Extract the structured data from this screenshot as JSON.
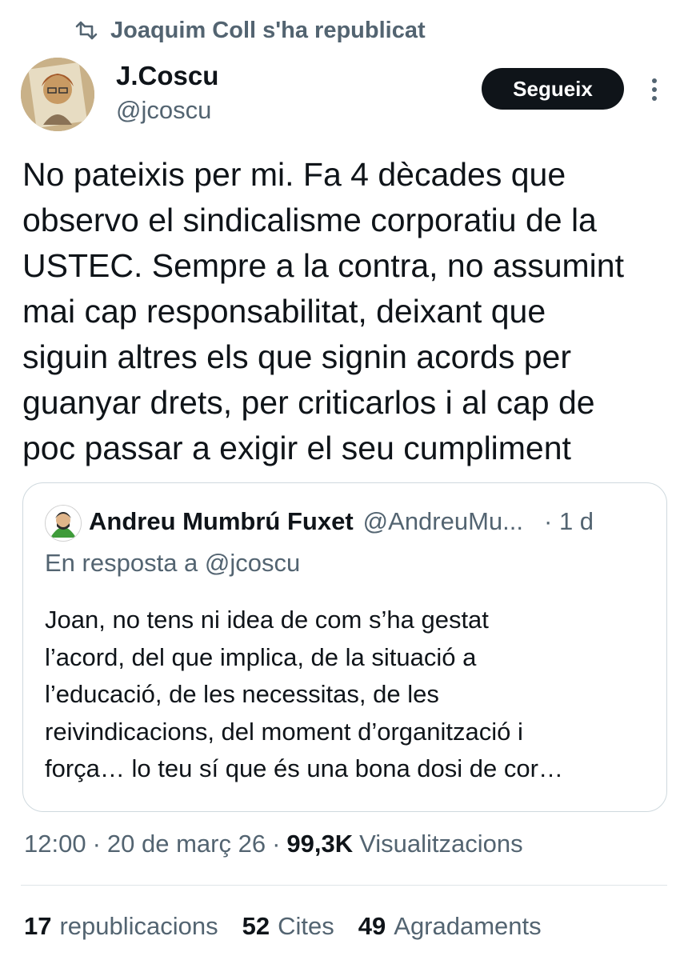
{
  "repost": {
    "label": "Joaquim Coll s'ha republicat",
    "icon": "repost-icon"
  },
  "author": {
    "name": "J.Coscu",
    "handle": "@jcoscu",
    "avatar_icon": "avatar"
  },
  "follow_label": "Segueix",
  "tweet_lines": [
    "No pateixis per mi. Fa 4 dècades que",
    "observo el sindicalisme corporatiu de la",
    "USTEC. Sempre a la contra, no assumint",
    "mai cap responsabilitat, deixant que",
    "siguin altres els que signin acords per",
    "guanyar drets, per criticarlos i al cap de",
    "poc passar a exigir el seu cumpliment"
  ],
  "quote": {
    "name": "Andreu Mumbrú Fuxet",
    "handle": "@AndreuMu...",
    "time": "· 1 d",
    "reply_to": "En resposta a @jcoscu",
    "text_lines": [
      "Joan, no tens ni idea de com s’ha gestat",
      "l’acord, del que implica, de la situació a",
      "l’educació, de les necessitas, de les",
      "reivindicacions, del moment d’organització i",
      "força… lo teu sí que és una bona dosi de cor…"
    ]
  },
  "meta": {
    "time": "12:00",
    "date": "20 de març 26",
    "views_count": "99,3K",
    "views_label": "Visualitzacions",
    "separator": "·"
  },
  "stats": {
    "reposts_count": "17",
    "reposts_label": "republicacions",
    "quotes_count": "52",
    "quotes_label": "Cites",
    "likes_count": "49",
    "likes_label": "Agradaments"
  },
  "colors": {
    "text": "#0f1419",
    "secondary": "#536471",
    "border": "#cfd9de",
    "button_bg": "#0f1419"
  }
}
